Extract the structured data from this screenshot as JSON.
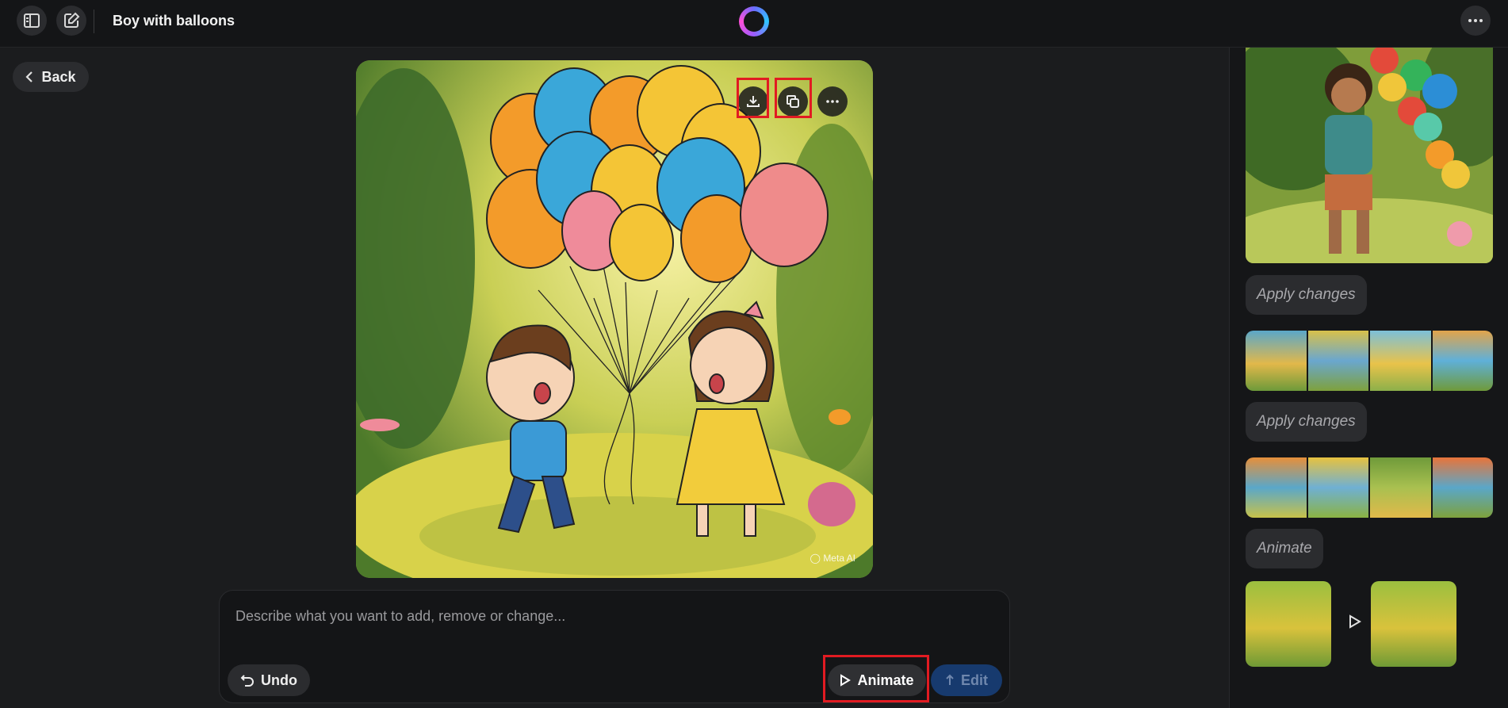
{
  "header": {
    "title": "Boy with balloons"
  },
  "nav": {
    "back_label": "Back"
  },
  "image": {
    "watermark": "Meta AI"
  },
  "composer": {
    "placeholder": "Describe what you want to add, remove or change...",
    "undo_label": "Undo",
    "animate_label": "Animate",
    "edit_label": "Edit"
  },
  "history": {
    "chips": [
      "Apply changes",
      "Apply changes",
      "Animate"
    ]
  },
  "colors": {
    "background": "#1b1c1e",
    "highlight": "#e11b22",
    "edit_button": "#173a6e"
  }
}
